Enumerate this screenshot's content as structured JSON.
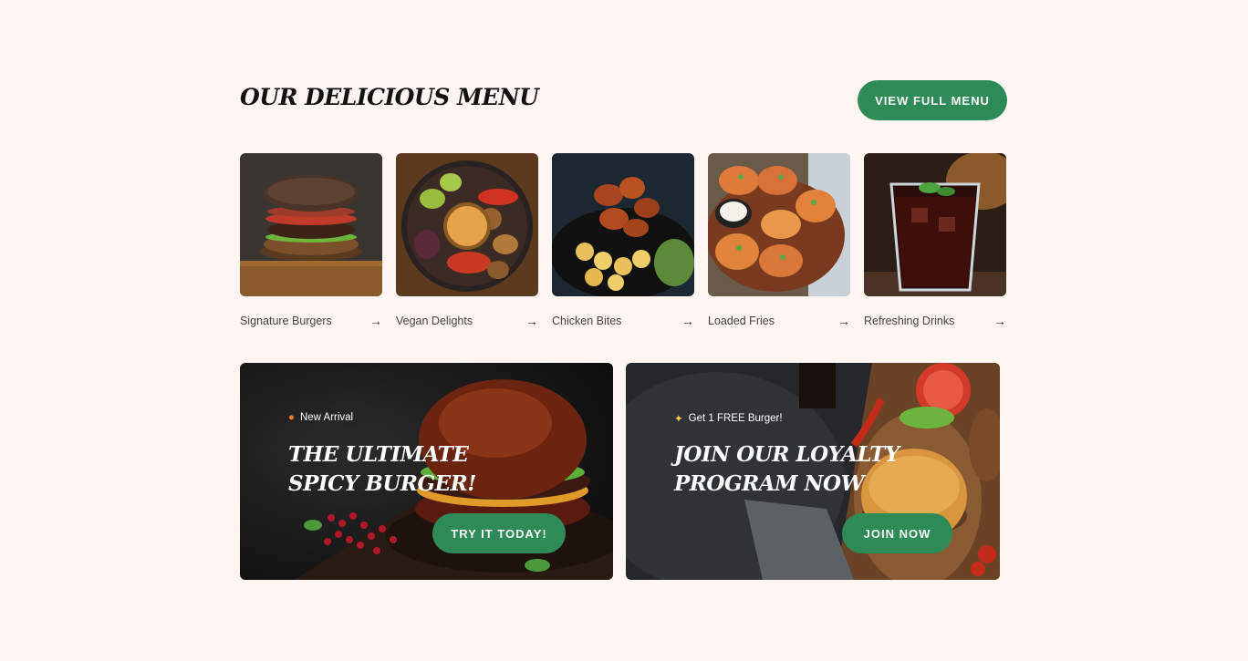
{
  "header": {
    "title": "Our Delicious Menu",
    "view_full_menu": "VIEW FULL MENU"
  },
  "categories": [
    {
      "label": "Signature Burgers",
      "icon": "arrow-right-icon"
    },
    {
      "label": "Vegan Delights",
      "icon": "arrow-right-icon"
    },
    {
      "label": "Chicken Bites",
      "icon": "arrow-right-icon"
    },
    {
      "label": "Loaded Fries",
      "icon": "arrow-right-icon"
    },
    {
      "label": "Refreshing Drinks",
      "icon": "arrow-right-icon"
    }
  ],
  "promos": [
    {
      "tag_icon": "fire-icon",
      "tag": "New Arrival",
      "title": "The Ultimate Spicy Burger!",
      "button": "TRY IT TODAY!"
    },
    {
      "tag_icon": "party-popper-icon",
      "tag": "Get 1 FREE Burger!",
      "title": "Join Our Loyalty Program Now",
      "button": "JOIN NOW"
    }
  ],
  "colors": {
    "accent": "#2e8b57",
    "background": "#fff5f2",
    "text": "#111111"
  }
}
